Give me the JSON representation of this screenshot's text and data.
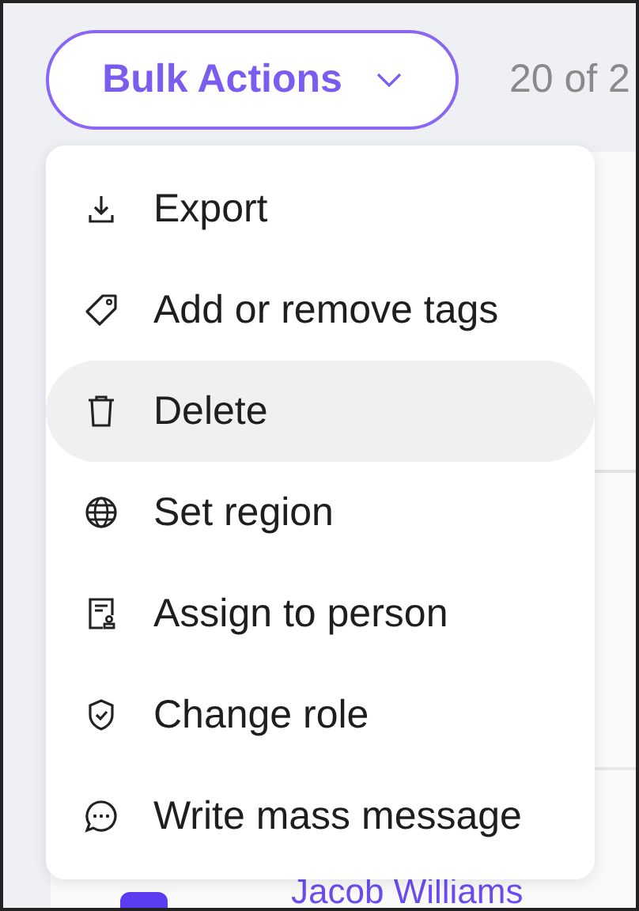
{
  "toolbar": {
    "button": "Bulk Actions",
    "count": "20 of 2"
  },
  "menu": {
    "items": [
      {
        "label": "Export",
        "selected": false
      },
      {
        "label": "Add or remove tags",
        "selected": false
      },
      {
        "label": "Delete",
        "selected": true
      },
      {
        "label": "Set region",
        "selected": false
      },
      {
        "label": "Assign to person",
        "selected": false
      },
      {
        "label": "Change role",
        "selected": false
      },
      {
        "label": "Write mass message",
        "selected": false
      }
    ]
  },
  "table": {
    "rows": [
      {
        "name": "Jacob Williams",
        "checked": true
      }
    ]
  }
}
